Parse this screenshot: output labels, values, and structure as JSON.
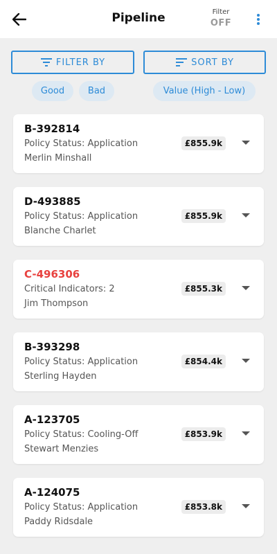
{
  "header": {
    "title": "Pipeline",
    "filter_label": "Filter",
    "filter_value": "OFF",
    "back_icon": "arrow-left-icon",
    "menu_icon": "more-vert-icon"
  },
  "toolbar": {
    "filter_by_label": "FILTER BY",
    "sort_by_label": "SORT BY"
  },
  "chips": {
    "good": "Good",
    "bad": "Bad",
    "sort": "Value (High - Low)"
  },
  "colors": {
    "accent": "#2d8bd7",
    "alert": "#e8423f",
    "chip_bg": "#dde9f3",
    "background": "#efefef"
  },
  "pipeline": [
    {
      "ref": "B-392814",
      "status": "Policy Status: Application",
      "name": "Merlin Minshall",
      "value": "£855.9k",
      "alert": false
    },
    {
      "ref": "D-493885",
      "status": "Policy Status: Application",
      "name": "Blanche Charlet",
      "value": "£855.9k",
      "alert": false
    },
    {
      "ref": "C-496306",
      "status": "Critical Indicators: 2",
      "name": "Jim Thompson",
      "value": "£855.3k",
      "alert": true
    },
    {
      "ref": "B-393298",
      "status": "Policy Status: Application",
      "name": "Sterling Hayden",
      "value": "£854.4k",
      "alert": false
    },
    {
      "ref": "A-123705",
      "status": "Policy Status: Cooling-Off",
      "name": "Stewart Menzies",
      "value": "£853.9k",
      "alert": false
    },
    {
      "ref": "A-124075",
      "status": "Policy Status: Application",
      "name": "Paddy Ridsdale",
      "value": "£853.8k",
      "alert": false
    }
  ]
}
